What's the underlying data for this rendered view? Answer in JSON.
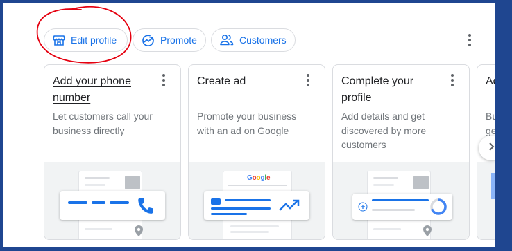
{
  "chips": {
    "edit_profile": "Edit profile",
    "promote": "Promote",
    "customers": "Customers"
  },
  "cards": [
    {
      "title": "Add your phone number",
      "description": "Let customers call your business directly"
    },
    {
      "title": "Create ad",
      "description": "Promote your business with an ad on Google",
      "illustration_brand": "Google"
    },
    {
      "title": "Complete your profile",
      "description": "Add details and get discovered by more customers"
    },
    {
      "title": "Ad",
      "description": "Bu ge"
    }
  ],
  "icons": {
    "edit_profile": "storefront-icon",
    "promote": "trending-up-icon",
    "customers": "people-icon",
    "more": "more-vert-icon",
    "next": "chevron-right-icon"
  },
  "colors": {
    "accent": "#1a73e8",
    "frame": "#1f4690",
    "annotation": "#e5000f",
    "google_blue": "#4285f4",
    "google_red": "#ea4335",
    "google_yellow": "#fbbc04",
    "google_green": "#34a853"
  }
}
